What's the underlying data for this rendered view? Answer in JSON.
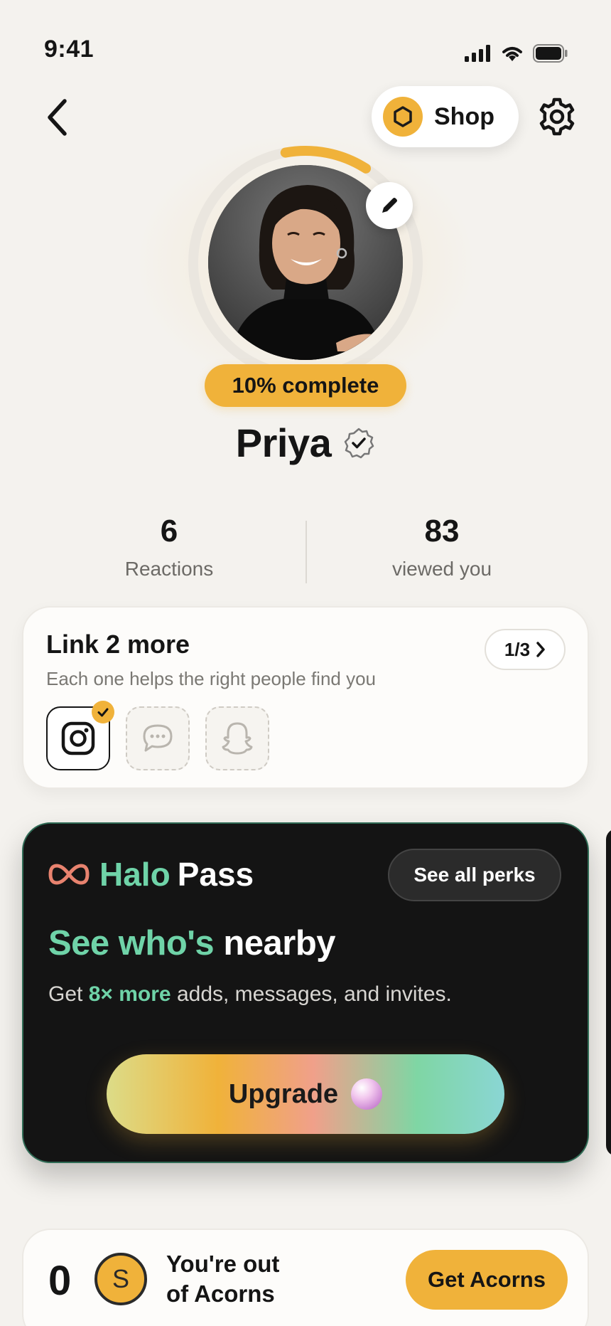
{
  "status_bar": {
    "time": "9:41"
  },
  "nav": {
    "shop_label": "Shop"
  },
  "profile": {
    "name": "Priya",
    "completion_label": "10% complete",
    "completion_percent": 10
  },
  "stats": [
    {
      "value": "6",
      "label": "Reactions"
    },
    {
      "value": "83",
      "label": "viewed you"
    }
  ],
  "link_card": {
    "title": "Link 2 more",
    "subtitle": "Each one helps the right people find you",
    "step": "1/3",
    "socials": [
      {
        "icon": "instagram-icon",
        "linked": true
      },
      {
        "icon": "chat-bubble-icon",
        "linked": false
      },
      {
        "icon": "snapchat-ghost-icon",
        "linked": false
      }
    ]
  },
  "pass_card": {
    "brand_word": "Halo",
    "title_word": "Pass",
    "perks_label": "See all perks",
    "headline_highlight": "See who's",
    "headline_rest": "nearby",
    "desc_prefix": "Get",
    "desc_highlight": "8× more",
    "desc_suffix": "adds, messages, and invites.",
    "upgrade_label": "Upgrade"
  },
  "acorns": {
    "count": "0",
    "coin_letter": "S",
    "line1": "You're out",
    "line2": "of Acorns",
    "button_label": "Get Acorns"
  },
  "colors": {
    "accent": "#f0b23a",
    "pass_green": "#6fd3a8",
    "infinity": "#e8836f",
    "background": "#f4f2ee"
  }
}
